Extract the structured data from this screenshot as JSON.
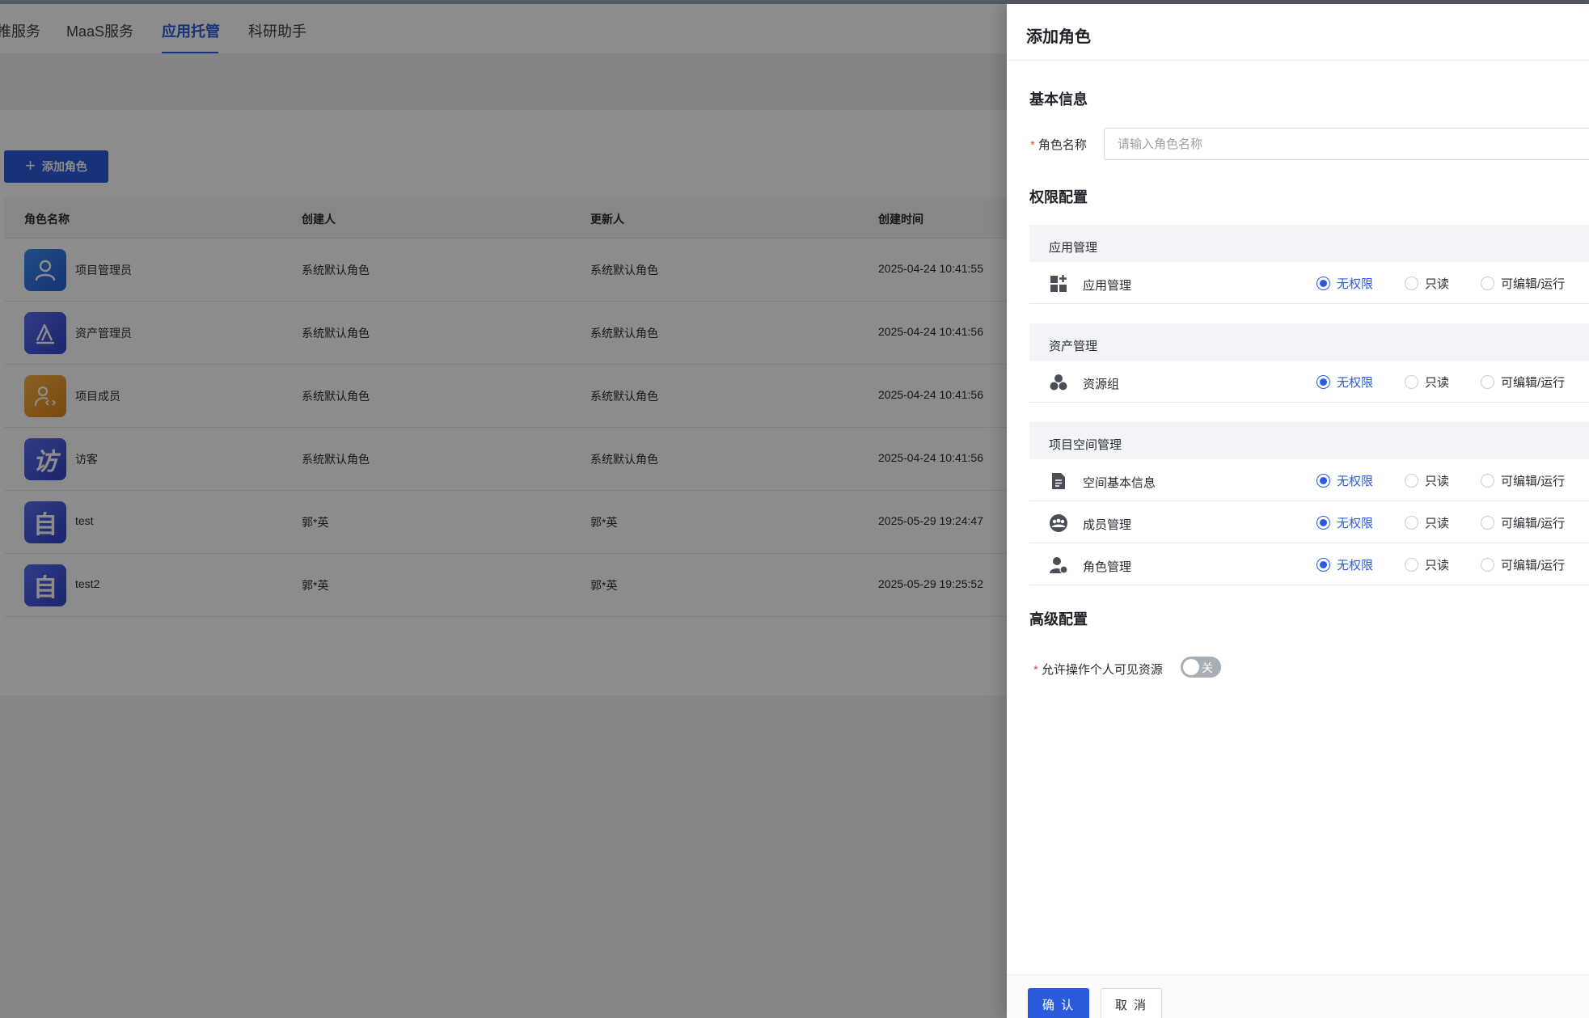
{
  "nav": {
    "tabs": [
      {
        "label": "推服务"
      },
      {
        "label": "MaaS服务"
      },
      {
        "label": "应用托管",
        "active": true
      },
      {
        "label": "科研助手"
      }
    ]
  },
  "page": {
    "add_button_label": "添加角色",
    "table": {
      "headers": [
        "角色名称",
        "创建人",
        "更新人",
        "创建时间"
      ],
      "rows": [
        {
          "name": "项目管理员",
          "creator": "系统默认角色",
          "updater": "系统默认角色",
          "created": "2025-04-24 10:41:55",
          "avatar": "user-icon"
        },
        {
          "name": "资产管理员",
          "creator": "系统默认角色",
          "updater": "系统默认角色",
          "created": "2025-04-24 10:41:56",
          "avatar": "asset-a-icon"
        },
        {
          "name": "项目成员",
          "creator": "系统默认角色",
          "updater": "系统默认角色",
          "created": "2025-04-24 10:41:56",
          "avatar": "member-code-icon"
        },
        {
          "name": "访客",
          "creator": "系统默认角色",
          "updater": "系统默认角色",
          "created": "2025-04-24 10:41:56",
          "avatar": "visitor-icon",
          "avatar_text": "访"
        },
        {
          "name": "test",
          "creator": "郭*英",
          "updater": "郭*英",
          "created": "2025-05-29 19:24:47",
          "avatar": "custom-icon",
          "avatar_text": "自"
        },
        {
          "name": "test2",
          "creator": "郭*英",
          "updater": "郭*英",
          "created": "2025-05-29 19:25:52",
          "avatar": "custom-icon",
          "avatar_text": "自"
        }
      ]
    }
  },
  "drawer": {
    "title": "添加角色",
    "basic": {
      "section_title": "基本信息",
      "required_mark": "*",
      "name_label": "角色名称",
      "name_placeholder": "请输入角色名称",
      "name_value": ""
    },
    "permissions": {
      "section_title": "权限配置",
      "options": [
        "无权限",
        "只读",
        "可编辑/运行"
      ],
      "groups": [
        {
          "title": "应用管理",
          "items": [
            {
              "label": "应用管理",
              "icon": "apps-icon",
              "selected": "无权限"
            }
          ]
        },
        {
          "title": "资产管理",
          "items": [
            {
              "label": "资源组",
              "icon": "resource-group-icon",
              "selected": "无权限"
            }
          ]
        },
        {
          "title": "项目空间管理",
          "items": [
            {
              "label": "空间基本信息",
              "icon": "document-icon",
              "selected": "无权限"
            },
            {
              "label": "成员管理",
              "icon": "members-icon",
              "selected": "无权限"
            },
            {
              "label": "角色管理",
              "icon": "role-user-icon",
              "selected": "无权限"
            }
          ]
        }
      ]
    },
    "advanced": {
      "section_title": "高级配置",
      "required_mark": "*",
      "toggle_label": "允许操作个人可见资源",
      "toggle_text": "关",
      "toggle_on": false
    },
    "footer": {
      "confirm_label": "确 认",
      "cancel_label": "取 消"
    },
    "colors": {
      "primary": "#2b5bdc",
      "required": "#e34d59"
    }
  }
}
